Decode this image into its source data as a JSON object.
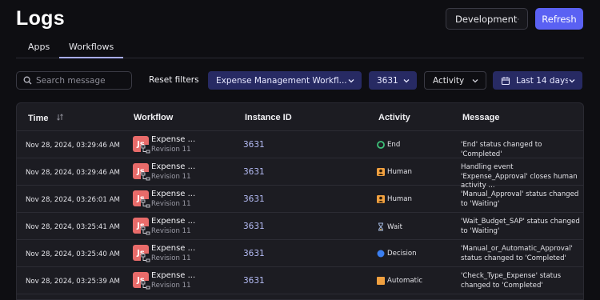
{
  "header": {
    "title": "Logs",
    "environment": "Development",
    "refresh_label": "Refresh"
  },
  "tabs": [
    {
      "label": "Apps",
      "active": false
    },
    {
      "label": "Workflows",
      "active": true
    }
  ],
  "filters": {
    "search_placeholder": "Search message",
    "reset_label": "Reset filters",
    "workflow": "Expense Management Workfl...",
    "instance": "3631",
    "activity": "Activity",
    "date_range": "Last 14 days"
  },
  "table": {
    "headers": {
      "time": "Time",
      "workflow": "Workflow",
      "instance": "Instance ID",
      "activity": "Activity",
      "message": "Message"
    },
    "rows": [
      {
        "time": "Nov 28, 2024, 03:29:46 AM",
        "workflow_name": "Expense ...",
        "workflow_icon_text": "Js",
        "revision": "Revision 11",
        "instance": "3631",
        "activity": "End",
        "activity_icon": "end-circle-icon",
        "message": "'End' status changed to 'Completed'"
      },
      {
        "time": "Nov 28, 2024, 03:29:46 AM",
        "workflow_name": "Expense ...",
        "workflow_icon_text": "Js",
        "revision": "Revision 11",
        "instance": "3631",
        "activity": "Human",
        "activity_icon": "person-icon",
        "message": "Handling event 'Expense_Approval' closes human activity ..."
      },
      {
        "time": "Nov 28, 2024, 03:26:01 AM",
        "workflow_name": "Expense ...",
        "workflow_icon_text": "Js",
        "revision": "Revision 11",
        "instance": "3631",
        "activity": "Human",
        "activity_icon": "person-icon",
        "message": "'Manual_Approval' status changed to 'Waiting'"
      },
      {
        "time": "Nov 28, 2024, 03:25:41 AM",
        "workflow_name": "Expense ...",
        "workflow_icon_text": "Js",
        "revision": "Revision 11",
        "instance": "3631",
        "activity": "Wait",
        "activity_icon": "hourglass-icon",
        "message": "'Wait_Budget_SAP' status changed to 'Waiting'"
      },
      {
        "time": "Nov 28, 2024, 03:25:40 AM",
        "workflow_name": "Expense ...",
        "workflow_icon_text": "Js",
        "revision": "Revision 11",
        "instance": "3631",
        "activity": "Decision",
        "activity_icon": "decision-circle-icon",
        "message": "'Manual_or_Automatic_Approval' status changed to 'Completed'"
      },
      {
        "time": "Nov 28, 2024, 03:25:39 AM",
        "workflow_name": "Expense ...",
        "workflow_icon_text": "Js",
        "revision": "Revision 11",
        "instance": "3631",
        "activity": "Automatic",
        "activity_icon": "automatic-square-icon",
        "message": "'Check_Type_Expense' status changed to 'Completed'"
      }
    ]
  },
  "colors": {
    "background": "#0e0e12",
    "table_background": "#1c1c22",
    "accent": "#5a61f3",
    "chip_background": "#272a63",
    "instance_link": "#b6bdf7",
    "workflow_badge": "#e86b6a",
    "end_green": "#3ec27a",
    "human_orange": "#f0a040",
    "decision_blue": "#3b7ff0"
  }
}
